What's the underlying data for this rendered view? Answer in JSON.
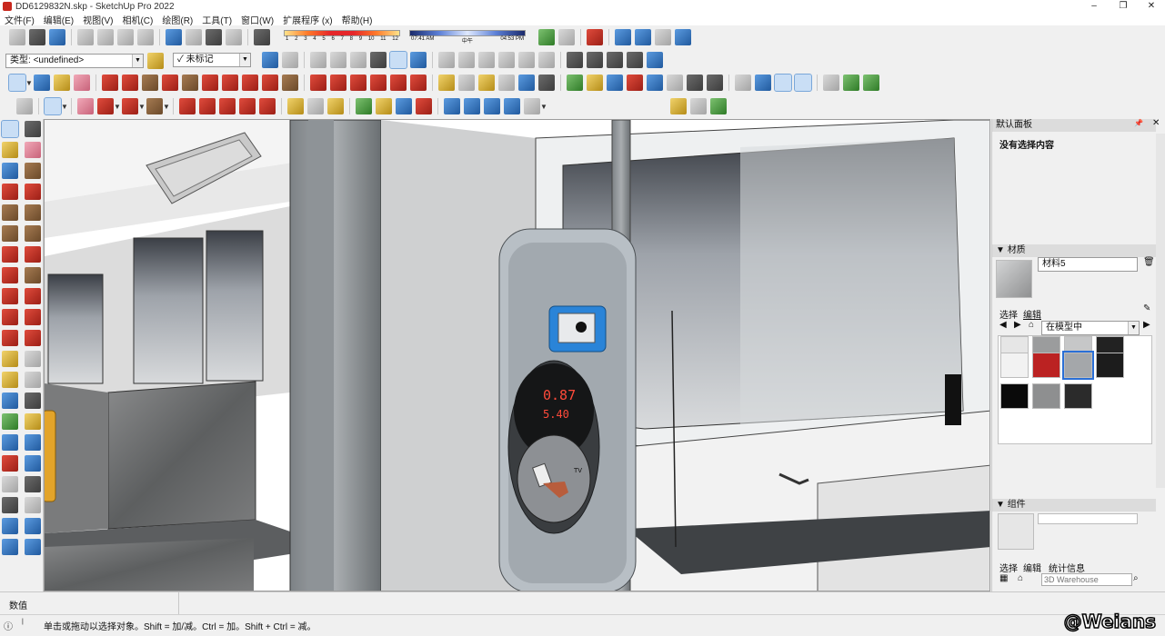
{
  "window": {
    "title": "DD6129832N.skp - SketchUp Pro 2022",
    "minimize": "–",
    "maximize": "❐",
    "close": "✕"
  },
  "menu": [
    "文件(F)",
    "编辑(E)",
    "视图(V)",
    "相机(C)",
    "绘图(R)",
    "工具(T)",
    "窗口(W)",
    "扩展程序 (x)",
    "帮助(H)"
  ],
  "shadow": {
    "ticks": [
      "1",
      "2",
      "3",
      "4",
      "5",
      "6",
      "7",
      "8",
      "9",
      "10",
      "11",
      "12"
    ],
    "time_start": "07:41 AM",
    "time_mid": "中午",
    "time_end": "04:53 PM"
  },
  "toolbar": {
    "type_label": "类型:",
    "type_value": "<undefined>",
    "tag_value": "未标记",
    "tag_check": "✓"
  },
  "right_panel": {
    "tray_title": "默认面板",
    "entity_info": "没有选择内容",
    "materials_header": "材质",
    "material_name": "材料5",
    "tab_select": "选择",
    "tab_edit": "编辑",
    "library_dropdown": "在模型中",
    "components_header": "组件",
    "comp_tab_select": "选择",
    "comp_tab_edit": "编辑",
    "comp_tab_stats": "统计信息",
    "warehouse_placeholder": "3D Warehouse"
  },
  "viewport": {
    "display_reading": "0.87",
    "display_reading2": "5.40",
    "card_brand": "TV"
  },
  "status": {
    "measurements_label": "数值",
    "hint": "单击或拖动以选择对象。Shift = 加/减。Ctrl = 加。Shift + Ctrl = 减。"
  },
  "watermark": "@Weians",
  "colors": {
    "accent": "#2a6fd6",
    "viewport_bg": "#ffffff",
    "panel_bg": "#f0f0f0"
  }
}
